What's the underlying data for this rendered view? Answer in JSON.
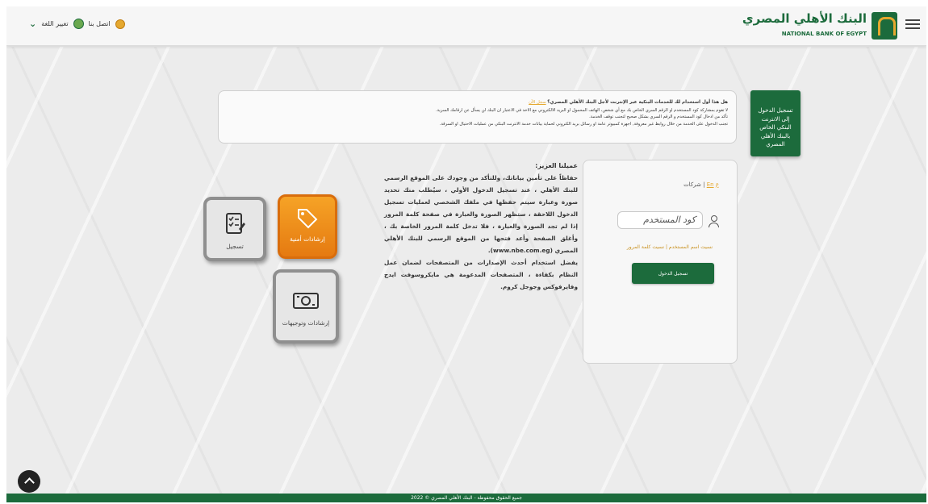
{
  "header": {
    "logo_ar": "البنك الأهلي المصري",
    "logo_en": "NATIONAL BANK OF EGYPT",
    "change_language": "تغيير اللغة",
    "contact_us": "اتصل بنا"
  },
  "side_banner": {
    "text": "تسجيل الدخول إلى الانترنت البنكي الخاص بالبنك الأهلي المصري"
  },
  "notice": {
    "question": "هل هذا أول استخدام لك للخدمات البنكية عبر الإنترنت لأجل البنك الأهلي المصري؟",
    "register_link": "سجل الآن",
    "line1": "لا تقوم بمشاركة كود المستخدم او الرقم السري الخاص بك مع أي شخص، الهاتف المحمول او البريد الالكتروني مع الاخذ في الاعتبار ان البنك لن يسأل عن ارقامك السرية.",
    "line2": "تأكد من ادخال كود المستخدم و الرقم السري بشكل صحيح لتجنب توقف الخدمة.",
    "line3": "تجنب الدخول على الخدمة من خلال روابط غير معروفة, اجهزة كمبيوتر عامة او رسائل بريد الكتروني لحماية بيانات خدمة الانترنت البنكي من عمليات الاحتيال او السرقة."
  },
  "login": {
    "lang_ar": "ع",
    "lang_en": "En",
    "lang_company": "شركات",
    "username_placeholder": "كود المستخدم",
    "forgot_username": "نسيت اسم المستخدم",
    "forgot_password": "نسيت كلمة المرور",
    "login_button": "تسجيل الدخول"
  },
  "message": {
    "greeting": "عميلنا العزيز:",
    "paragraph1": "حفاظاً على تأمين بياناتك، وللتأكد من وجودك على الموقع الرسمي للبنك الأهلي ، عند تسجيل الدخول الأولي ، سيُطلب منك تحديد صورة وعبارة سيتم حفظها في ملفك الشخصي لعمليات تسجيل الدخول اللاحقة ، ستظهر الصورة والعبارة في صفحة كلمة المرور إذا لم تجد الصورة والعبارة ، فلا تدخل كلمة المرور الخاصة بك ، وأغلق الصفحة وأعد فتحها من الموقع الرسمي للبنك الأهلي المصري (www.nbe.com.eg).",
    "paragraph2": "يفضل استخدام أحدث الإصدارات من المتصفحات لضمان عمل النظام بكفاءة ، المتصفحات المدعومة هي مايكروسوفت ايدج وفايرفوكس وجوجل كروم."
  },
  "tiles": {
    "register": "تسجيل",
    "security": "إرشادات أمنية",
    "guides": "إرشادات وتوجيهات"
  },
  "footer": {
    "copyright": "جميع الحقوق محفوظة - البنك الأهلي المصري © 2022"
  },
  "colors": {
    "brand_green": "#1c6b3c",
    "accent_gold": "#e5a82f",
    "tile_orange": "#f39a22"
  }
}
